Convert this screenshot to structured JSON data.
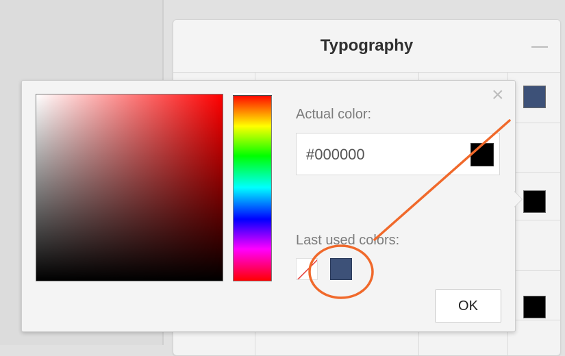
{
  "panel": {
    "title": "Typography",
    "collapse_icon": "minus-icon",
    "swatch_colors": [
      "#3d5178",
      "#000000",
      "#000000"
    ]
  },
  "picker": {
    "actual_color_label": "Actual color:",
    "actual_color_value": "#000000",
    "actual_color_preview": "#000000",
    "last_used_label": "Last used colors:",
    "last_used_colors": [
      "none",
      "#3d5178"
    ],
    "ok_label": "OK",
    "close_icon": "close-icon",
    "hue": "#ff0000"
  },
  "annotation": {
    "color": "#f0692b"
  }
}
